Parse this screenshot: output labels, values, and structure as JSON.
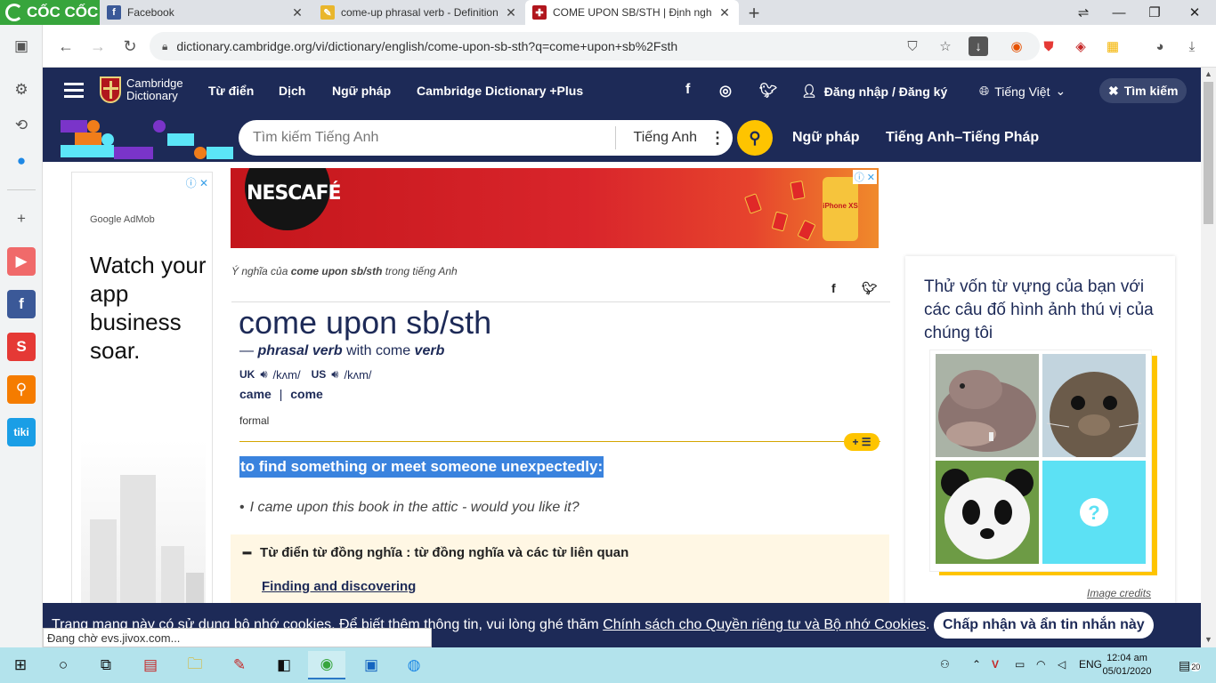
{
  "browser": {
    "brand": "CỐC CỐC",
    "tabs": [
      {
        "title": "Facebook",
        "active": false
      },
      {
        "title": "come-up phrasal verb - Definition",
        "active": false
      },
      {
        "title": "COME UPON SB/STH | Định nghĩa",
        "active": true
      }
    ],
    "url": "dictionary.cambridge.org/vi/dictionary/english/come-upon-sb-sth?q=come+upon+sb%2Fsth",
    "status": "Đang chờ evs.jivox.com..."
  },
  "site": {
    "logo_line1": "Cambridge",
    "logo_line2": "Dictionary",
    "nav": [
      "Từ điển",
      "Dịch",
      "Ngữ pháp",
      "Cambridge Dictionary +Plus"
    ],
    "login": "Đăng nhập / Đăng ký",
    "language": "Tiếng Việt",
    "search_toggle": "Tìm kiếm",
    "search_placeholder": "Tìm kiếm Tiếng Anh",
    "search_dict": "Tiếng Anh",
    "band_links": [
      "Ngữ pháp",
      "Tiếng Anh–Tiếng Pháp"
    ]
  },
  "left_ad": {
    "admob": "Google AdMob",
    "headline": "Watch your app business soar."
  },
  "banner_ad": {
    "brand": "NESCAFÉ",
    "phone_label": "iPhone XS"
  },
  "entry": {
    "crumb_pre": "Ý nghĩa của ",
    "crumb_word": "come upon sb/sth",
    "crumb_post": " trong tiếng Anh",
    "headword": "come upon sb/sth",
    "pos_dash": "—",
    "pos_type": "phrasal verb",
    "pos_with": "with come",
    "pos_verb": "verb",
    "uk_label": "UK",
    "uk_ipa": "/kʌm/",
    "us_label": "US",
    "us_ipa": "/kʌm/",
    "form1": "came",
    "form_sep": "|",
    "form2": "come",
    "register": "formal",
    "definition": "to find something or meet someone unexpectedly:",
    "example": "I came upon this book in the attic - would you like it?",
    "thesaurus_heading": "Từ điển từ đồng nghĩa : từ đồng nghĩa và các từ liên quan",
    "thesaurus_link": "Finding and discovering"
  },
  "quiz": {
    "title": "Thử vốn từ vựng của bạn với các câu đố hình ảnh thú vị của chúng tôi",
    "credits": "Image credits"
  },
  "cookie": {
    "text_pre": "Trang mạng này có sử dụng bộ nhớ cookies. Để biết thêm thông tin, vui lòng ghé thăm ",
    "link": "Chính sách cho Quyền riêng tư và Bộ nhớ Cookies",
    "text_post": ".",
    "button": "Chấp nhận và ẩn tin nhắn này"
  },
  "taskbar": {
    "lang": "ENG",
    "time": "12:04 am",
    "date": "05/01/2020",
    "notifications": "20"
  }
}
